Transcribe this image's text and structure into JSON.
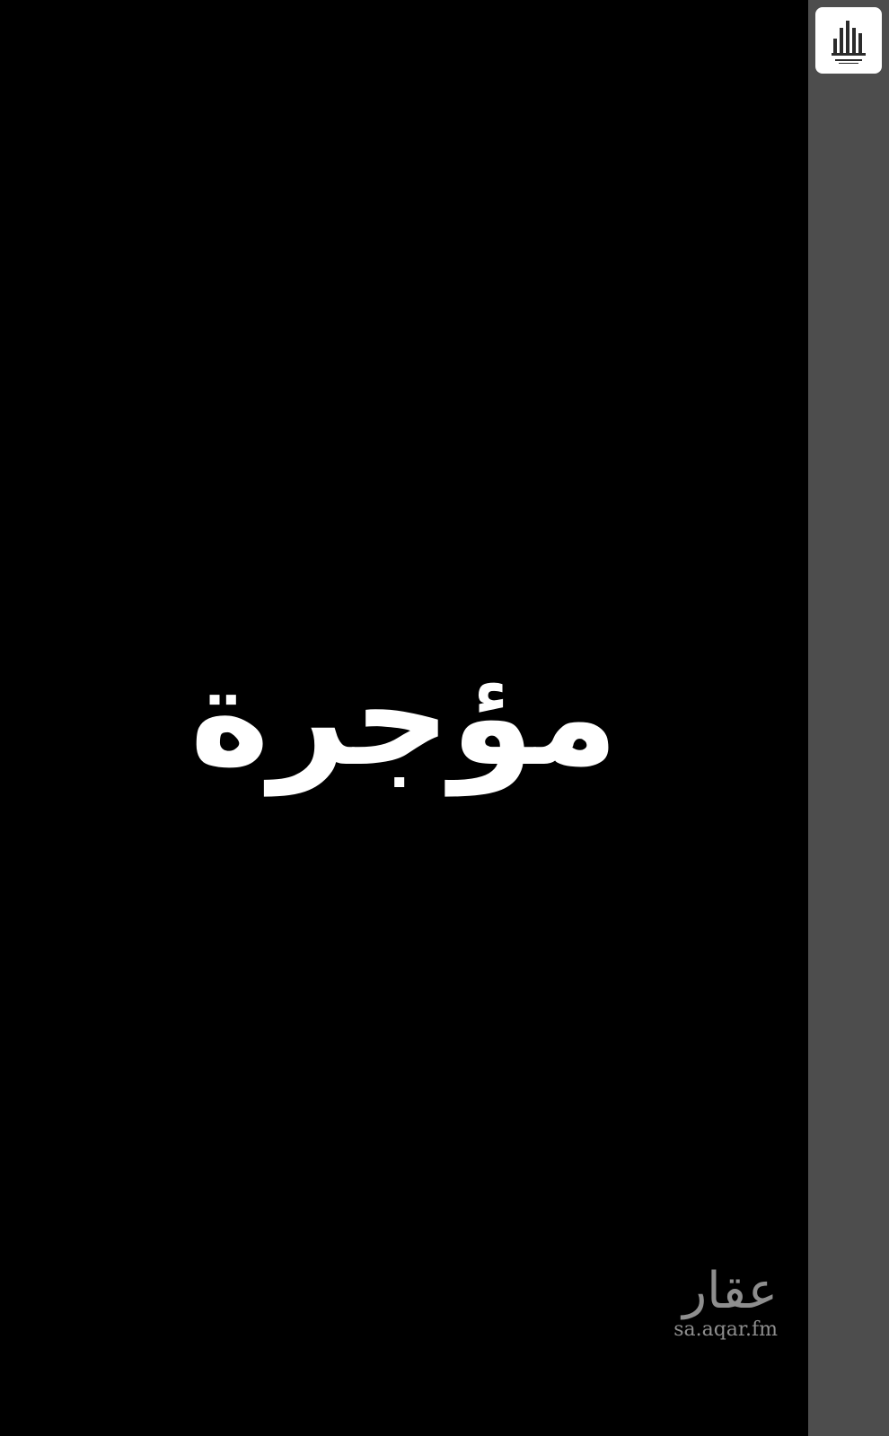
{
  "main": {
    "headline": "مؤجرة"
  },
  "watermark": {
    "arabic": "عقار",
    "url": "sa.aqar.fm"
  },
  "colors": {
    "background": "#000000",
    "side_strip": "#4d4d4d",
    "headline": "#ffffff",
    "watermark": "#8e8e8e"
  },
  "icons": {
    "corner_logo": "building-skyline-logo"
  }
}
